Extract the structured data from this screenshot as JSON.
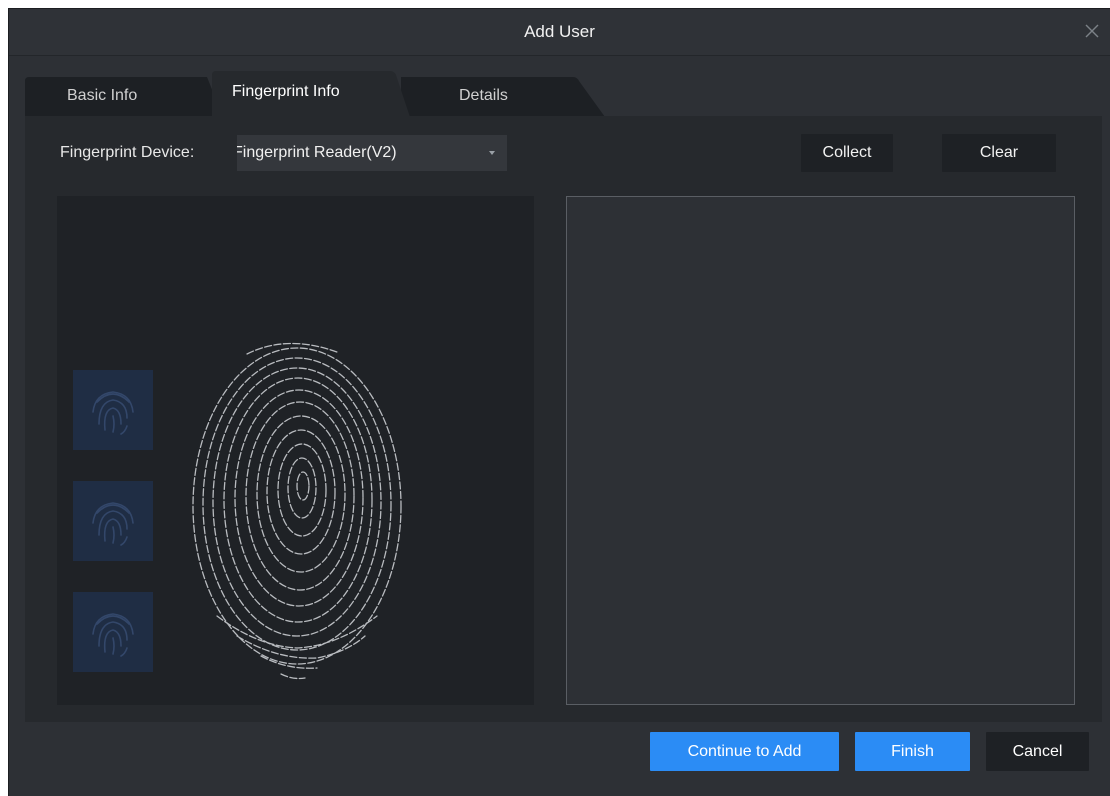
{
  "dialog": {
    "title": "Add User",
    "close_icon": "close-icon"
  },
  "tabs": [
    {
      "label": "Basic Info",
      "active": false
    },
    {
      "label": "Fingerprint Info",
      "active": true
    },
    {
      "label": "Details",
      "active": false
    }
  ],
  "fingerprint": {
    "device_label": "Fingerprint Device:",
    "device_value": "Fingerprint Reader(V2)",
    "collect_label": "Collect",
    "clear_label": "Clear",
    "thumbnail_icon": "fingerprint-icon",
    "thumbnail_count": 3
  },
  "footer": {
    "continue_label": "Continue to Add",
    "finish_label": "Finish",
    "cancel_label": "Cancel"
  },
  "colors": {
    "background": "#2d3035",
    "panel": "#26292d",
    "primary": "#2b8cf5",
    "dark_button": "#1e2125",
    "thumbnail": "#1f2d44"
  }
}
